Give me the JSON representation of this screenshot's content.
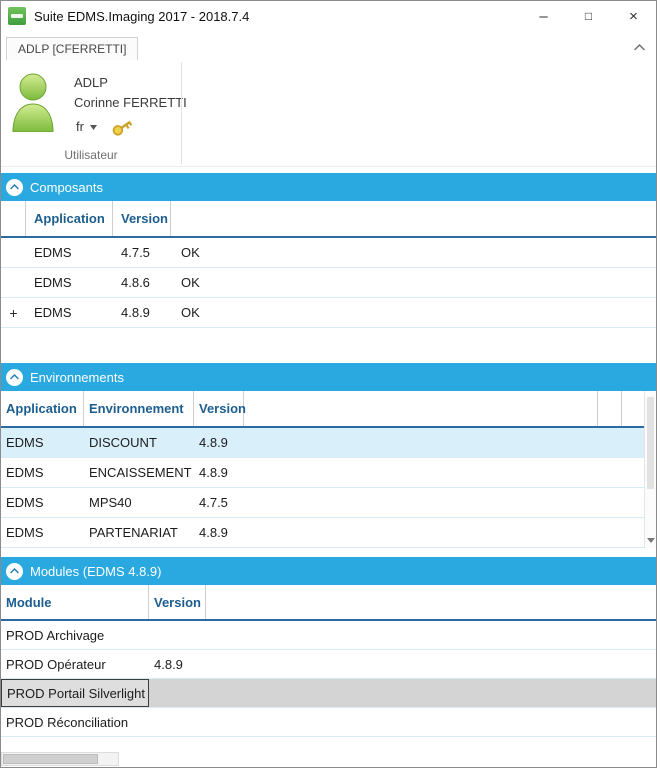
{
  "window": {
    "title": "Suite EDMS.Imaging 2017 - 2018.7.4",
    "controls": {
      "minimize": "–",
      "maximize": "□",
      "close": "×"
    }
  },
  "ribbon": {
    "tab_label": "ADLP [CFERRETTI]",
    "user": {
      "title": "ADLP",
      "name": "Corinne FERRETTI",
      "language": "fr"
    },
    "group_label": "Utilisateur"
  },
  "icons": {
    "app": "green-app-logo",
    "ribbon_collapse": "chevron-up",
    "section_collapse": "chevron-up",
    "language_dropdown": "chevron-down",
    "password_key": "key",
    "user_avatar": "person-silhouette",
    "scroll_down": "chevron-down"
  },
  "colors": {
    "section_header": "#29A9E0",
    "table_header_text": "#1D5E8F",
    "header_underline": "#2D6A9F",
    "row_divider": "#D7ECF7",
    "selected_row": "#D9F0FB",
    "selected_module_row": "#D4D4D4",
    "avatar_green": "#8CC63F",
    "key_gold": "#C9A227"
  },
  "sections": {
    "composants": {
      "title": "Composants",
      "columns": {
        "application": "Application",
        "version": "Version"
      },
      "rows": [
        {
          "expander": "",
          "application": "EDMS",
          "version": "4.7.5",
          "status": "OK"
        },
        {
          "expander": "",
          "application": "EDMS",
          "version": "4.8.6",
          "status": "OK"
        },
        {
          "expander": "+",
          "application": "EDMS",
          "version": "4.8.9",
          "status": "OK"
        }
      ]
    },
    "environnements": {
      "title": "Environnements",
      "columns": {
        "application": "Application",
        "environnement": "Environnement",
        "version": "Version"
      },
      "rows": [
        {
          "application": "EDMS",
          "environnement": "DISCOUNT",
          "version": "4.8.9",
          "selected": true
        },
        {
          "application": "EDMS",
          "environnement": "ENCAISSEMENT",
          "version": "4.8.9",
          "selected": false
        },
        {
          "application": "EDMS",
          "environnement": "MPS40",
          "version": "4.7.5",
          "selected": false
        },
        {
          "application": "EDMS",
          "environnement": "PARTENARIAT",
          "version": "4.8.9",
          "selected": false
        }
      ]
    },
    "modules": {
      "title": "Modules (EDMS 4.8.9)",
      "columns": {
        "module": "Module",
        "version": "Version"
      },
      "rows": [
        {
          "module": "PROD Archivage",
          "version": "",
          "selected": false
        },
        {
          "module": "PROD Opérateur",
          "version": "4.8.9",
          "selected": false
        },
        {
          "module": "PROD Portail Silverlight",
          "version": "",
          "selected": true
        },
        {
          "module": "PROD Réconciliation",
          "version": "",
          "selected": false
        }
      ]
    }
  }
}
